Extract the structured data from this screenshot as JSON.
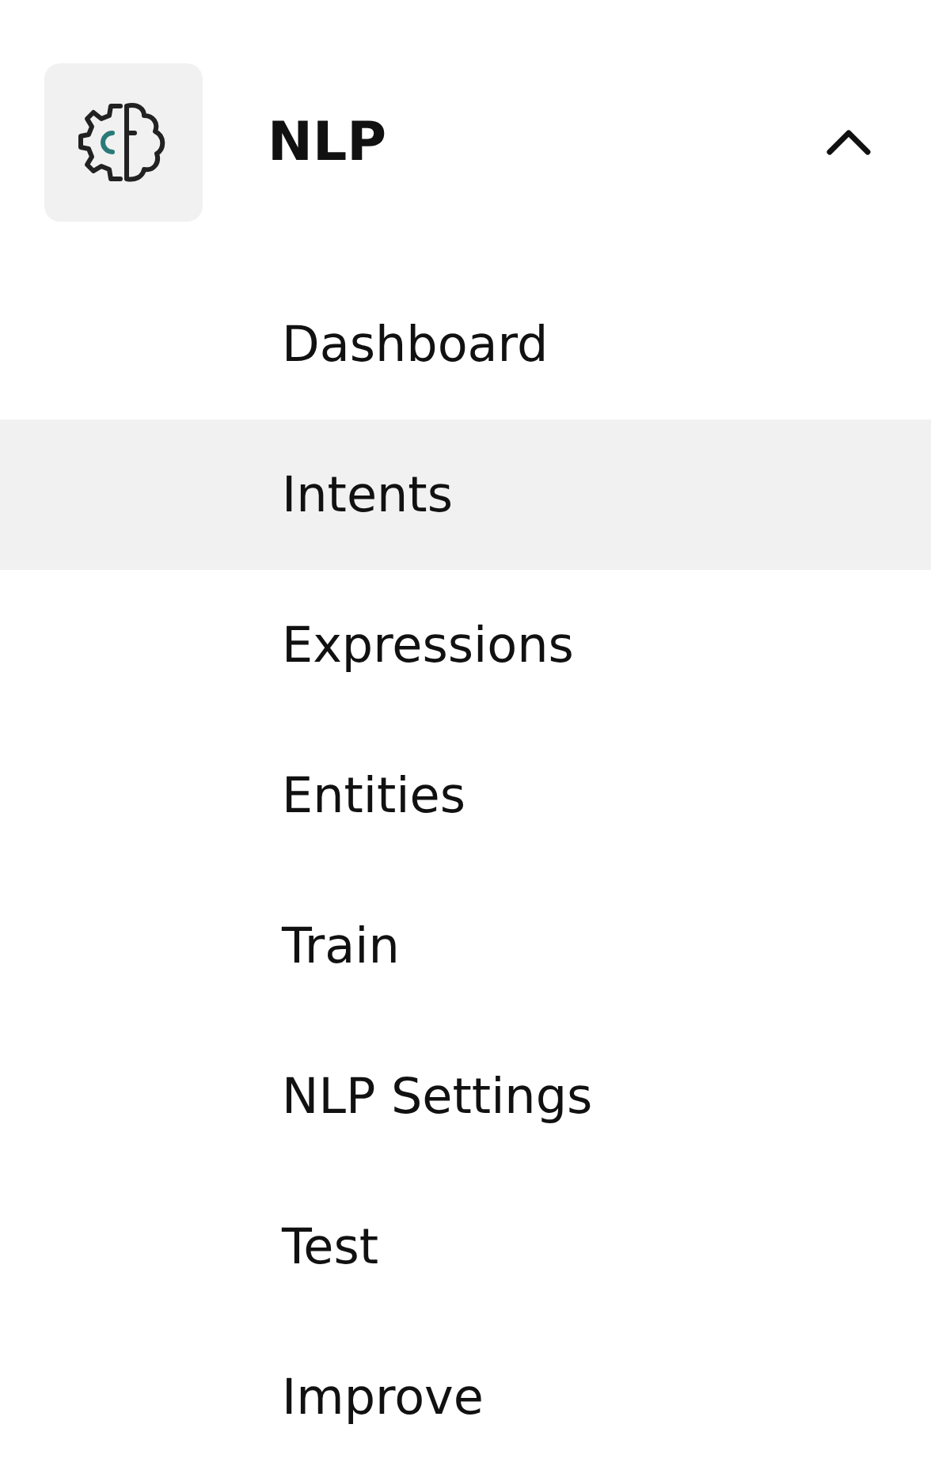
{
  "section": {
    "title": "NLP",
    "expanded": true
  },
  "items": [
    {
      "label": "Dashboard",
      "selected": false
    },
    {
      "label": "Intents",
      "selected": true
    },
    {
      "label": "Expressions",
      "selected": false
    },
    {
      "label": "Entities",
      "selected": false
    },
    {
      "label": "Train",
      "selected": false
    },
    {
      "label": "NLP Settings",
      "selected": false
    },
    {
      "label": "Test",
      "selected": false
    },
    {
      "label": "Improve",
      "selected": false
    }
  ]
}
